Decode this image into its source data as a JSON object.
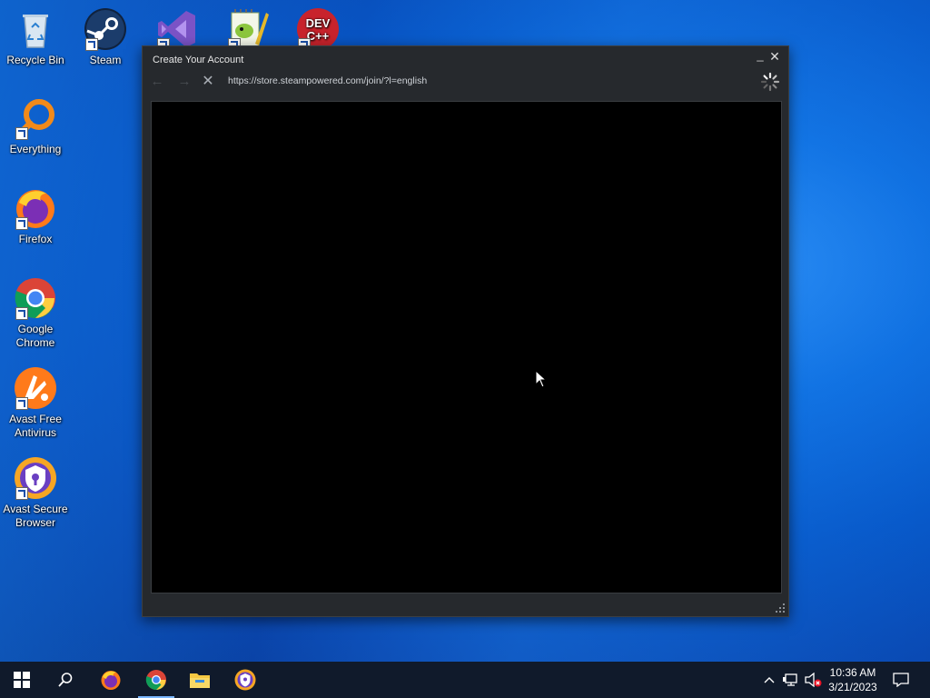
{
  "desktop": {
    "icons": [
      {
        "label": "Recycle Bin",
        "icon": "recycle-bin-icon"
      },
      {
        "label": "Steam",
        "icon": "steam-icon"
      },
      {
        "label": "",
        "icon": "visual-studio-icon"
      },
      {
        "label": "",
        "icon": "notepad-plus-plus-icon"
      },
      {
        "label": "",
        "icon": "dev-cpp-icon",
        "badge_text": "DEV C++"
      },
      {
        "label": "Everything",
        "icon": "everything-search-icon"
      },
      {
        "label": "Firefox",
        "icon": "firefox-icon"
      },
      {
        "label": "Google Chrome",
        "icon": "chrome-icon"
      },
      {
        "label": "Avast Free Antivirus",
        "icon": "avast-antivirus-icon"
      },
      {
        "label": "Avast Secure Browser",
        "icon": "avast-secure-browser-icon"
      }
    ]
  },
  "window": {
    "title": "Create Your Account",
    "minimize_glyph": "_",
    "close_glyph": "✕",
    "nav": {
      "back": "←",
      "forward": "→",
      "stop": "✕"
    },
    "url": "https://store.steampowered.com/join/?l=english",
    "loading": true
  },
  "taskbar": {
    "pinned": [
      "windows-start-icon",
      "search-icon",
      "firefox-icon",
      "chrome-icon",
      "file-explorer-icon",
      "avast-secure-browser-icon"
    ],
    "active_app": "chrome-icon",
    "tray": {
      "chevron": "^"
    },
    "time": "10:36 AM",
    "date": "3/21/2023"
  },
  "colors": {
    "window_bg": "#26292d",
    "content_bg": "#000000",
    "taskbar_bg": "#101a2b",
    "desktop_accent": "#0758c9"
  }
}
